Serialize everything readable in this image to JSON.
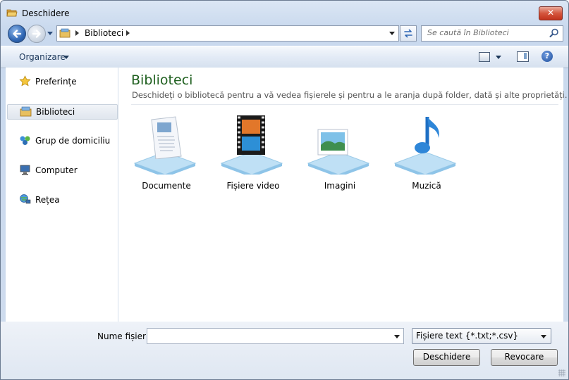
{
  "window": {
    "title": "Deschidere",
    "close_glyph": "✕"
  },
  "nav": {
    "address_path": "Biblioteci",
    "search_placeholder": "Se caută în Biblioteci"
  },
  "toolbar": {
    "organize_label": "Organizare",
    "help_glyph": "?"
  },
  "sidebar": {
    "items": [
      {
        "label": "Preferințe",
        "icon": "star-icon"
      },
      {
        "label": "Biblioteci",
        "icon": "libraries-icon",
        "selected": true
      },
      {
        "label": "Grup de domiciliu",
        "icon": "homegroup-icon"
      },
      {
        "label": "Computer",
        "icon": "computer-icon"
      },
      {
        "label": "Rețea",
        "icon": "network-icon"
      }
    ]
  },
  "main": {
    "heading": "Biblioteci",
    "description": "Deschideți o bibliotecă pentru a vă vedea fișierele și pentru a le aranja după folder, dată și alte proprietăți.",
    "libraries": [
      {
        "label": "Documente",
        "icon": "documents-library-icon"
      },
      {
        "label": "Fișiere video",
        "icon": "videos-library-icon"
      },
      {
        "label": "Imagini",
        "icon": "pictures-library-icon"
      },
      {
        "label": "Muzică",
        "icon": "music-library-icon"
      }
    ]
  },
  "footer": {
    "filename_label": "Nume fișier:",
    "filename_value": "",
    "filetype_selected": "Fișiere text {*.txt;*.csv}",
    "open_label": "Deschidere",
    "cancel_label": "Revocare"
  },
  "colors": {
    "heading": "#1e5f1e",
    "close_button": "#c2331c",
    "accent": "#2f66b3"
  }
}
